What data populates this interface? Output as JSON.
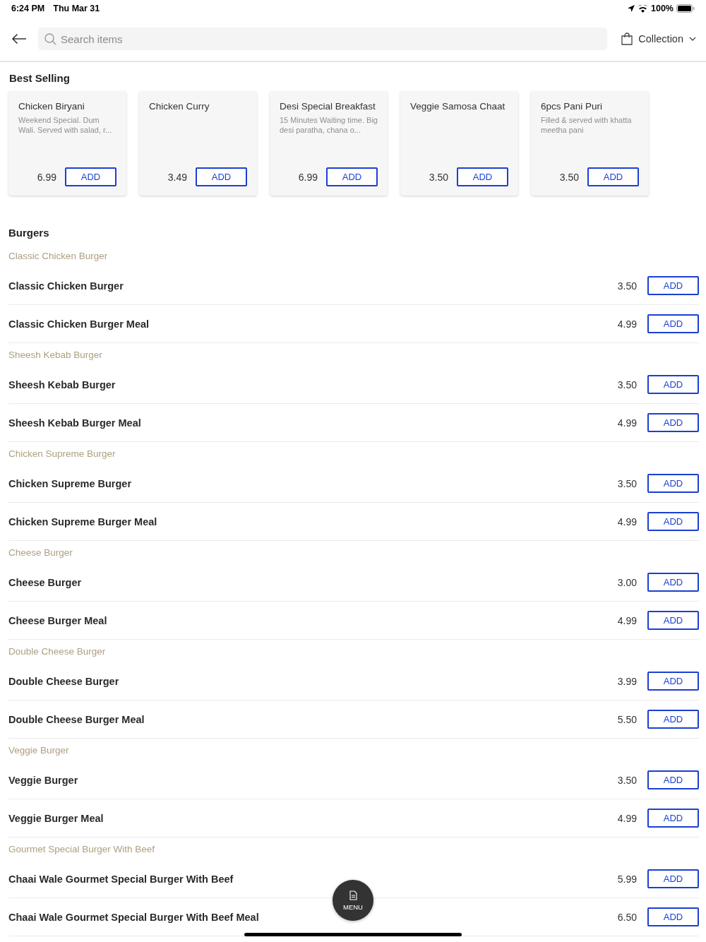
{
  "status_bar": {
    "time": "6:24 PM",
    "date": "Thu Mar 31",
    "battery": "100%"
  },
  "header": {
    "search": {
      "placeholder": "Search items"
    },
    "order_mode": "Collection"
  },
  "best_selling": {
    "title": "Best Selling",
    "items": [
      {
        "name": "Chicken Biryani",
        "description": "Weekend Special. Dum Wali. Served with salad, r...",
        "price": "6.99",
        "button": "ADD"
      },
      {
        "name": "Chicken Curry",
        "price": "3.49",
        "button": "ADD"
      },
      {
        "name": "Desi Special Breakfast",
        "description": "15 Minutes Waiting time. Big desi paratha, chana o...",
        "price": "6.99",
        "button": "ADD"
      },
      {
        "name": "Veggie Samosa Chaat",
        "price": "3.50",
        "button": "ADD"
      },
      {
        "name": "6pcs Pani Puri",
        "description": "Filled & served with khatta meetha pani",
        "price": "3.50",
        "button": "ADD"
      }
    ]
  },
  "menu_section": {
    "title": "Burgers",
    "groups": [
      {
        "title": "Classic Chicken Burger",
        "items": [
          {
            "name": "Classic Chicken Burger",
            "price": "3.50",
            "button": "ADD"
          },
          {
            "name": "Classic Chicken Burger Meal",
            "price": "4.99",
            "button": "ADD"
          }
        ]
      },
      {
        "title": "Sheesh Kebab Burger",
        "items": [
          {
            "name": "Sheesh Kebab Burger",
            "price": "3.50",
            "button": "ADD"
          },
          {
            "name": "Sheesh Kebab Burger Meal",
            "price": "4.99",
            "button": "ADD"
          }
        ]
      },
      {
        "title": "Chicken Supreme Burger",
        "items": [
          {
            "name": "Chicken Supreme Burger",
            "price": "3.50",
            "button": "ADD"
          },
          {
            "name": "Chicken Supreme Burger Meal",
            "price": "4.99",
            "button": "ADD"
          }
        ]
      },
      {
        "title": "Cheese Burger",
        "items": [
          {
            "name": "Cheese Burger",
            "price": "3.00",
            "button": "ADD"
          },
          {
            "name": "Cheese Burger Meal",
            "price": "4.99",
            "button": "ADD"
          }
        ]
      },
      {
        "title": "Double Cheese Burger",
        "items": [
          {
            "name": "Double Cheese Burger",
            "price": "3.99",
            "button": "ADD"
          },
          {
            "name": "Double Cheese Burger Meal",
            "price": "5.50",
            "button": "ADD"
          }
        ]
      },
      {
        "title": "Veggie Burger",
        "items": [
          {
            "name": "Veggie Burger",
            "price": "3.50",
            "button": "ADD"
          },
          {
            "name": "Veggie Burger Meal",
            "price": "4.99",
            "button": "ADD"
          }
        ]
      },
      {
        "title": "Gourmet Special Burger With Beef",
        "items": [
          {
            "name": "Chaai Wale Gourmet Special Burger With Beef",
            "price": "5.99",
            "button": "ADD"
          },
          {
            "name": "Chaai Wale Gourmet Special Burger With Beef Meal",
            "price": "6.50",
            "button": "ADD"
          }
        ]
      }
    ]
  },
  "menu_button": {
    "label": "MENU"
  }
}
